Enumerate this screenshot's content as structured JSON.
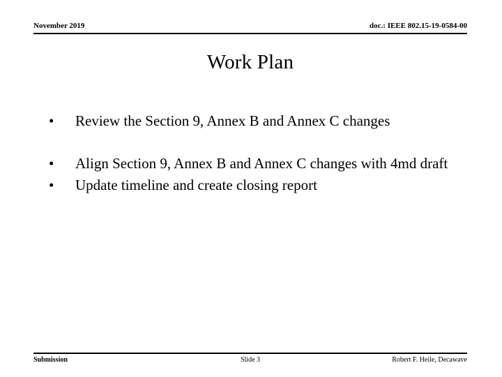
{
  "slide": {
    "header": {
      "date": "November 2019",
      "doc": "doc.: IEEE 802.15-19-0584-00"
    },
    "title": "Work Plan",
    "bullets": [
      {
        "marker": "•",
        "text": "Review the Section 9, Annex B and Annex C changes",
        "spacing": "large"
      },
      {
        "marker": "•",
        "text": "Align Section 9, Annex B and Annex C changes with 4md draft",
        "spacing": "large"
      },
      {
        "marker": "•",
        "text": "Update timeline and create closing report",
        "spacing": "none"
      }
    ],
    "footer": {
      "left": "Submission",
      "center": "Slide 3",
      "right": "Robert F. Heile, Decawave"
    }
  }
}
